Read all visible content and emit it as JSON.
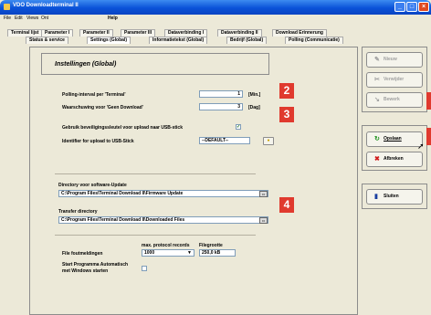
{
  "window": {
    "title": "VDO Downloadterminal II"
  },
  "menu": [
    "File",
    "Edit",
    "Views",
    "Ont",
    "Help"
  ],
  "tabs_row1": [
    "Terminal lijst",
    "Parameter I",
    "Parameter II",
    "Parameter III",
    "Dataverbinding I",
    "Dataverbinding II",
    "Download Erinnerung"
  ],
  "tabs_row2": [
    "Status & service",
    "Settings (Global)",
    "Informatietekst (Global)",
    "Bedrijf (Global)",
    "Polling (Communicatie)"
  ],
  "section_title": "Instellingen (Global)",
  "polling": {
    "label": "Polling-interval per 'Terminal'",
    "value": "1",
    "unit": "[Min.]",
    "badge": "2"
  },
  "warning": {
    "label": "Waarschuwing voor 'Geen Download'",
    "value": "3",
    "unit": "[Dag]",
    "badge": "3"
  },
  "usb_key": {
    "label": "Gebruik beveiligingssleutel voor upload naar USB-stick",
    "checked": "✓"
  },
  "usb_id": {
    "label": "Identifier for upload to USB-Stick",
    "value": "--DEFAULT--"
  },
  "software_update": {
    "label": "Directory voor software-Update",
    "value": "C:\\Program Files\\Terminal Download II\\Firmware Update"
  },
  "transfer": {
    "label": "Transfer directory",
    "value": "C:\\Program Files\\Terminal Download II\\Downloaded Files",
    "badge": "4"
  },
  "protocol": {
    "header_records": "max. protocol records",
    "header_size": "Filegrootte",
    "label": "File foutmeldingen",
    "records": "1000",
    "size": "250,0 kB"
  },
  "autostart": {
    "label_line1": "Start Programma Automatisch",
    "label_line2": "met Windows starten"
  },
  "buttons": {
    "nieuw": "Nieuw",
    "verwijder": "Verwijder",
    "bewerk": "Bewerk",
    "opslaan": "Opslaan",
    "afbreken": "Afbreken",
    "sluiten": "Sluiten"
  },
  "colors": {
    "badge": "#e03a2e",
    "titlebar": "#0a52d8"
  }
}
